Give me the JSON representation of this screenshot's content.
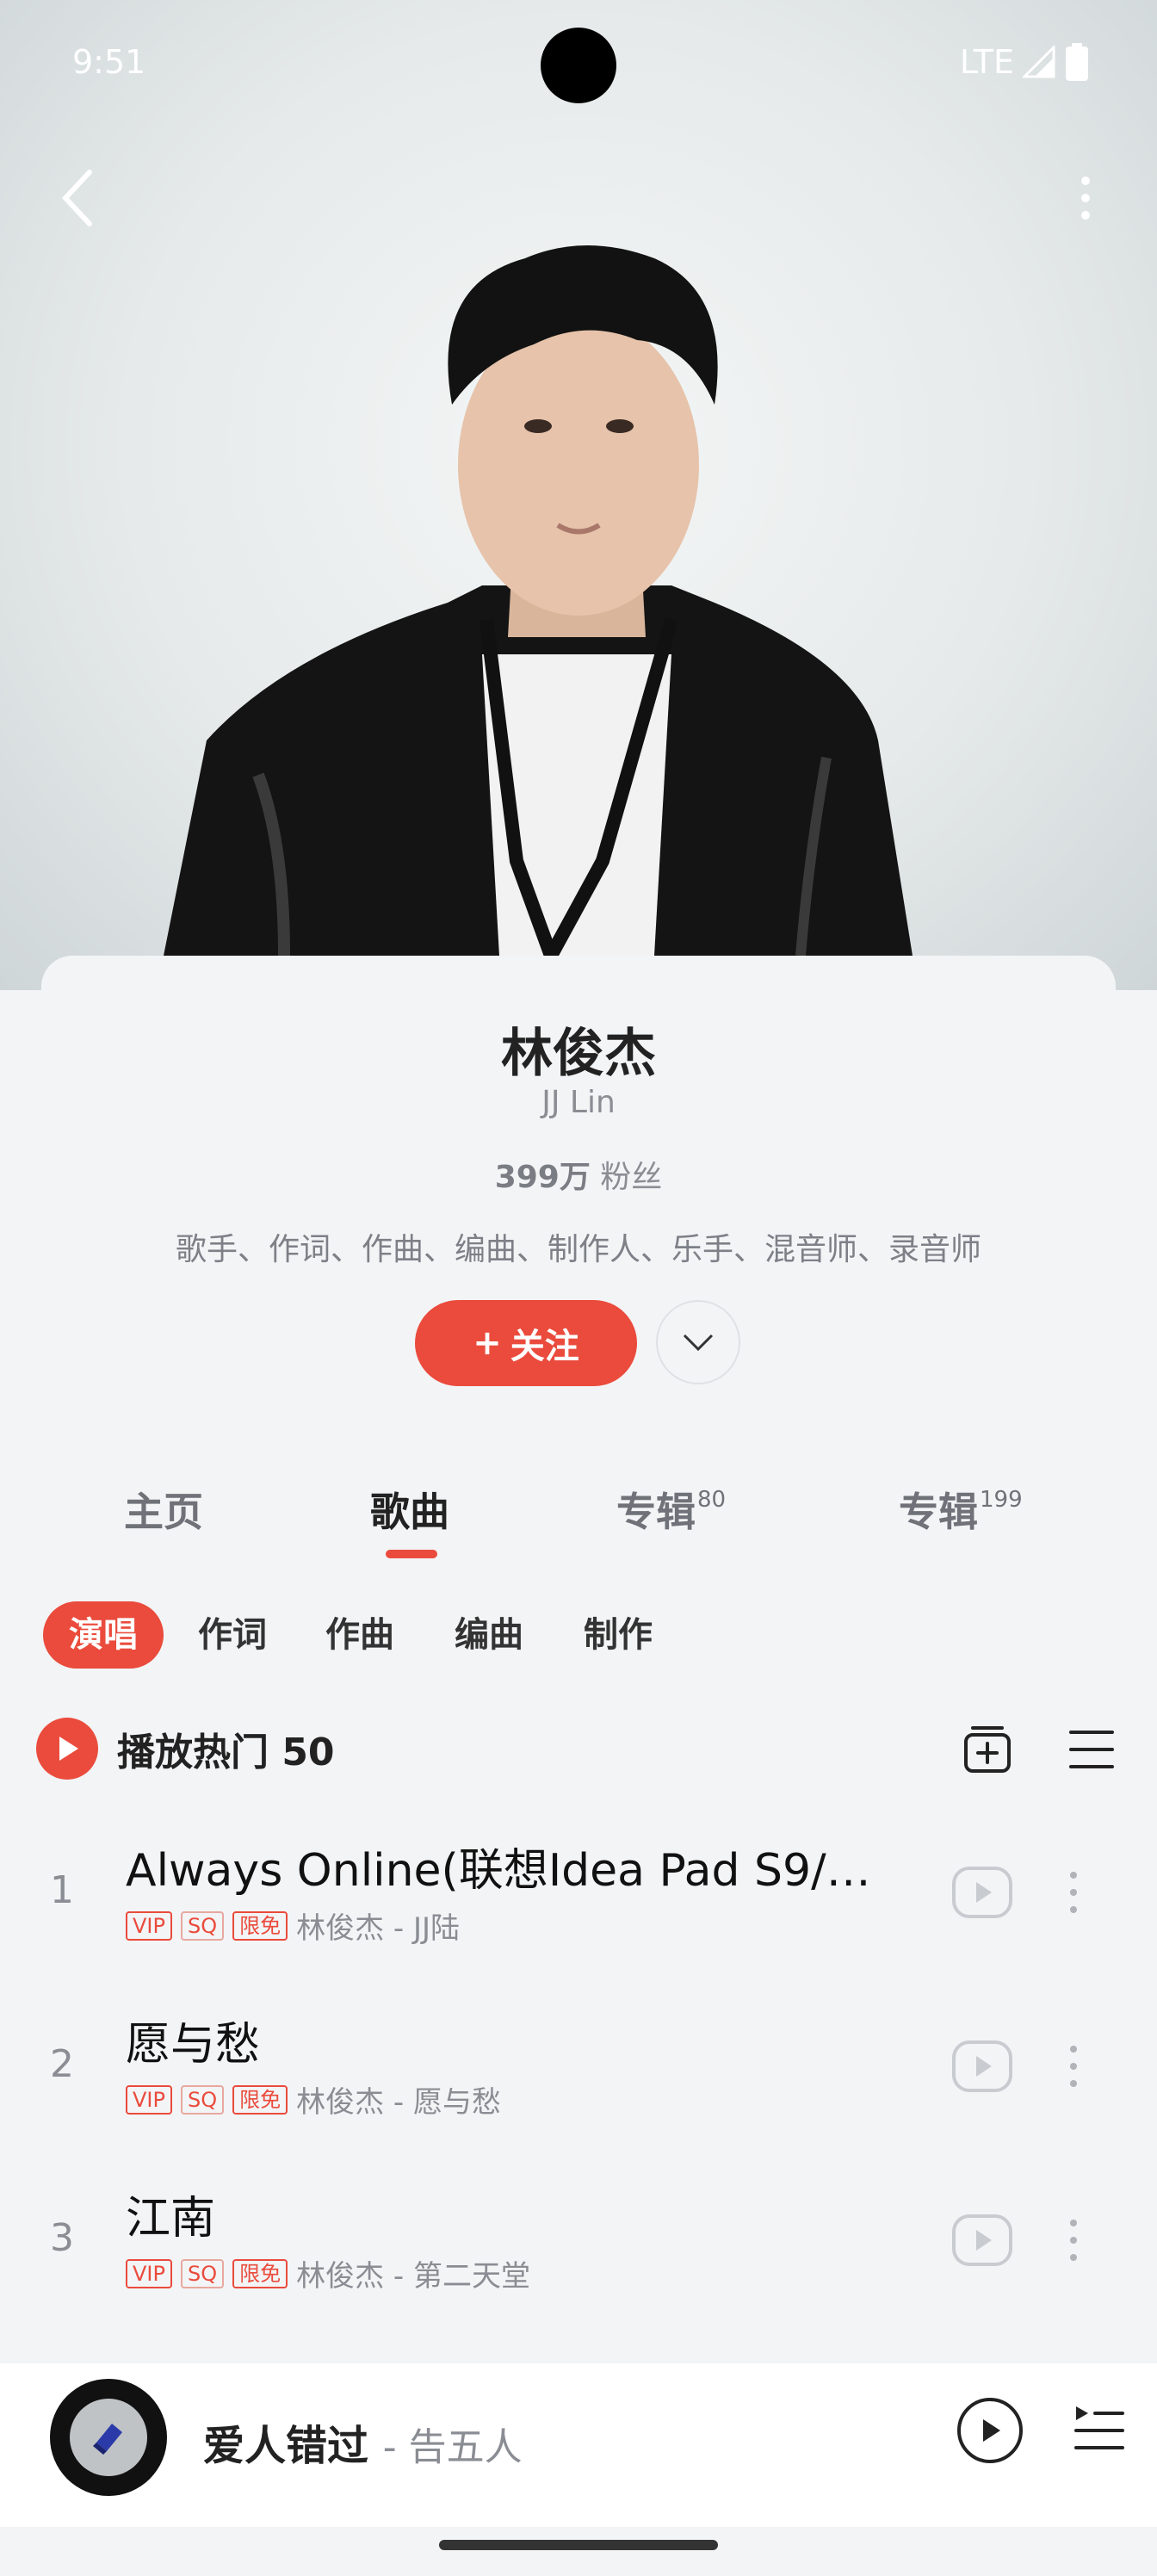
{
  "status": {
    "time": "9:51",
    "network": "LTE"
  },
  "header": {
    "back_icon": "chevron-left-icon",
    "more_icon": "vertical-dots-icon"
  },
  "artist": {
    "name": "林俊杰",
    "name_en": "JJ Lin",
    "fans_count": "399万",
    "fans_label": "粉丝",
    "roles": "歌手、作词、作曲、编曲、制作人、乐手、混音师、录音师",
    "follow_label": "关注",
    "follow_prefix": "+"
  },
  "tabs": [
    {
      "label": "主页",
      "badge": ""
    },
    {
      "label": "歌曲",
      "badge": ""
    },
    {
      "label": "专辑",
      "badge": "80"
    },
    {
      "label": "专辑",
      "badge": "199"
    }
  ],
  "chips": [
    "演唱",
    "作词",
    "作曲",
    "编曲",
    "制作"
  ],
  "play_hot": {
    "label": "播放热门 50"
  },
  "songs": [
    {
      "num": "1",
      "title": "Always Online(联想Idea Pad S9/…",
      "tags": [
        "VIP",
        "SQ",
        "限免"
      ],
      "meta": "林俊杰 - JJ陆"
    },
    {
      "num": "2",
      "title": "愿与愁",
      "tags": [
        "VIP",
        "SQ",
        "限免"
      ],
      "meta": "林俊杰 - 愿与愁"
    },
    {
      "num": "3",
      "title": "江南",
      "tags": [
        "VIP",
        "SQ",
        "限免"
      ],
      "meta": "林俊杰 - 第二天堂"
    }
  ],
  "now_playing": {
    "title": "爱人错过",
    "artist": "- 告五人"
  },
  "colors": {
    "accent": "#ea4b3c",
    "background": "#f3f4f6"
  }
}
